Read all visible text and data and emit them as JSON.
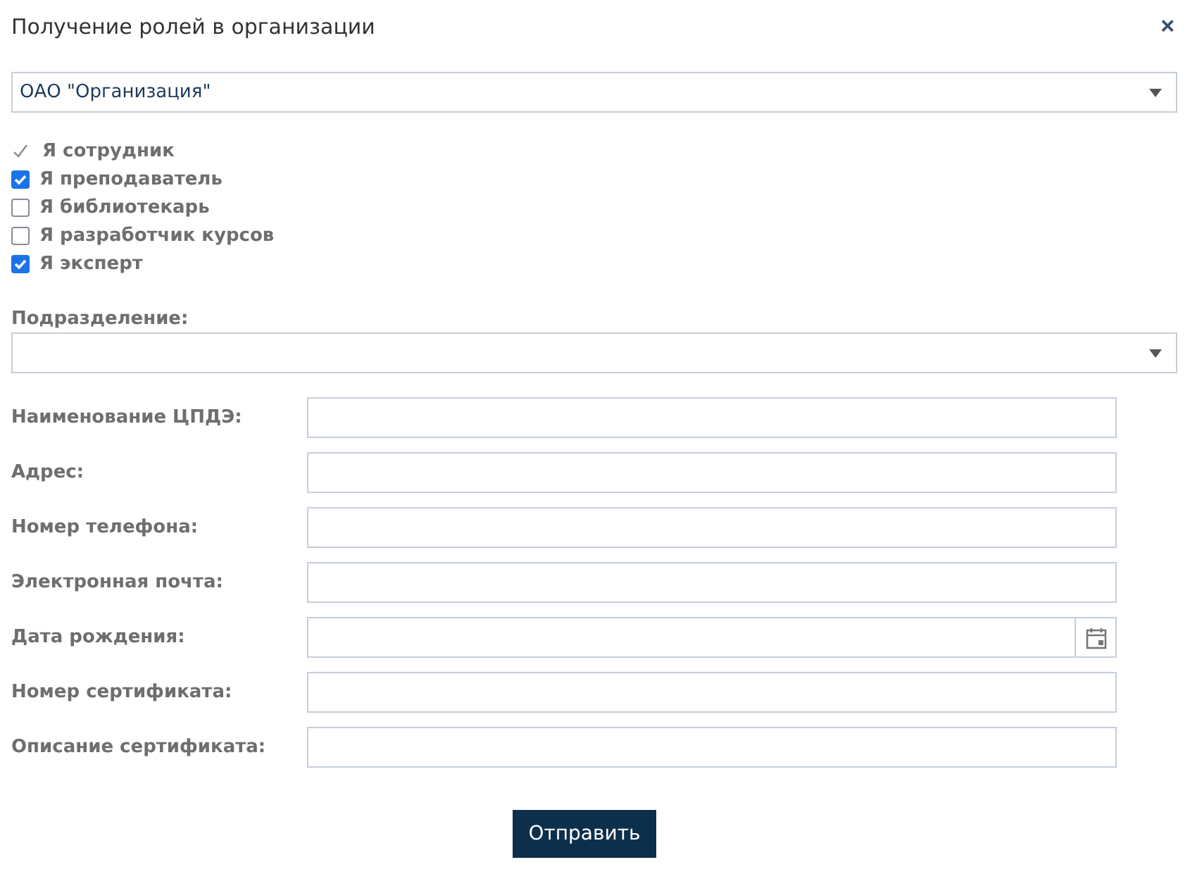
{
  "dialog": {
    "title": "Получение ролей в организации",
    "close": "×"
  },
  "organization": {
    "value": "ОАО \"Организация\""
  },
  "roles": [
    {
      "label": "Я сотрудник",
      "kind": "fixed",
      "checked": true
    },
    {
      "label": "Я преподаватель",
      "kind": "checkbox",
      "checked": true
    },
    {
      "label": "Я библиотекарь",
      "kind": "checkbox",
      "checked": false
    },
    {
      "label": "Я разработчик курсов",
      "kind": "checkbox",
      "checked": false
    },
    {
      "label": "Я эксперт",
      "kind": "checkbox",
      "checked": true
    }
  ],
  "department": {
    "label": "Подразделение:"
  },
  "fields": [
    {
      "label": "Наименование ЦПДЭ:",
      "kind": "text"
    },
    {
      "label": "Адрес:",
      "kind": "text"
    },
    {
      "label": "Номер телефона:",
      "kind": "text"
    },
    {
      "label": "Электронная почта:",
      "kind": "text"
    },
    {
      "label": "Дата рождения:",
      "kind": "date"
    },
    {
      "label": "Номер сертификата:",
      "kind": "text"
    },
    {
      "label": "Описание сертификата:",
      "kind": "text"
    }
  ],
  "submit": "Отправить"
}
